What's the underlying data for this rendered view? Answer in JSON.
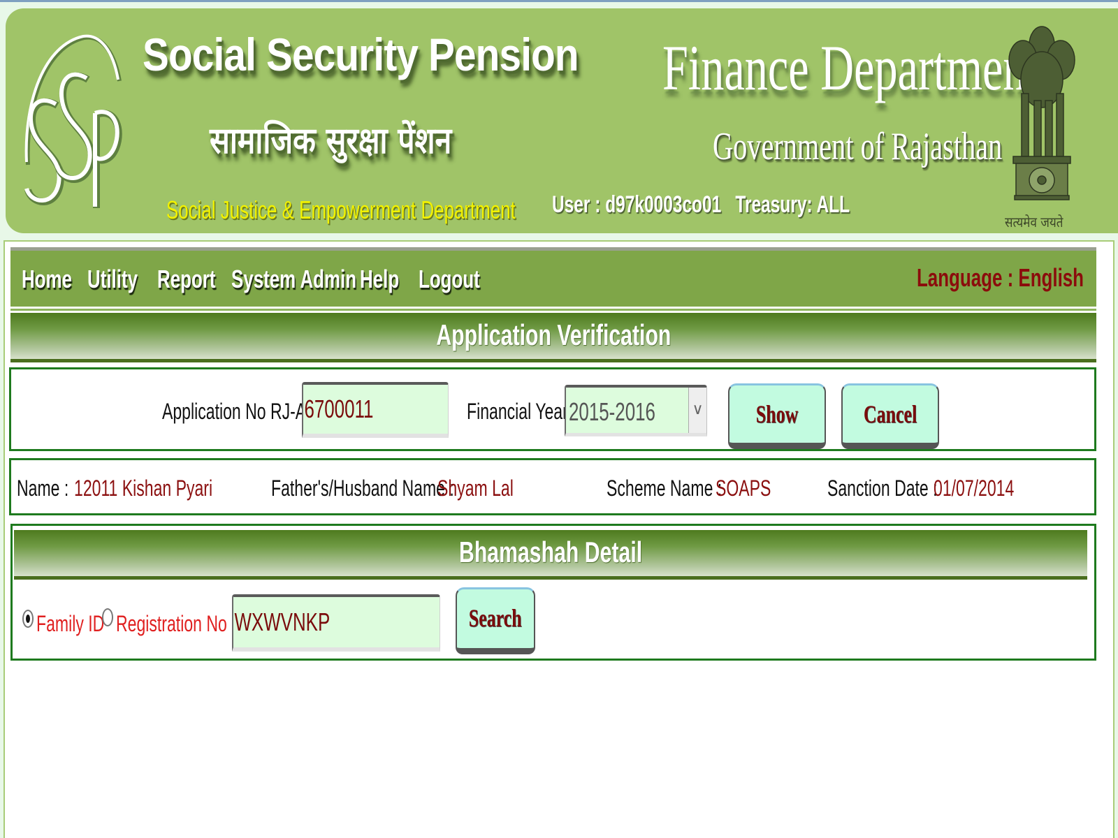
{
  "banner": {
    "logo_text": "SSP",
    "title_en": "Social Security Pension",
    "title_hi": "सामाजिक सुरक्षा पेंशन",
    "department": "Social Justice & Empowerment Department",
    "finance_dept": "Finance Department",
    "government": "Government of Rajasthan",
    "user_label": "User : d97k0003co01",
    "treasury_label": "Treasury: ALL",
    "emblem_motto": "सत्यमेव जयते"
  },
  "nav": {
    "items": [
      {
        "label": "Home"
      },
      {
        "label": "Utility"
      },
      {
        "label": "Report"
      },
      {
        "label": "System Admin"
      },
      {
        "label": "Help"
      },
      {
        "label": "Logout"
      }
    ],
    "language": "Language : English"
  },
  "verification": {
    "title": "Application Verification",
    "app_no_label": "Application No RJ-A-",
    "app_no_value": "6700011",
    "fy_label": "Financial Year",
    "fy_value": "2015-2016",
    "show_button": "Show",
    "cancel_button": "Cancel"
  },
  "applicant": {
    "name_label": "Name :",
    "name_value": "12011 Kishan Pyari",
    "father_label": "Father's/Husband Name :",
    "father_value": "Shyam Lal",
    "scheme_label": "Scheme Name :",
    "scheme_value": "SOAPS",
    "sanction_label": "Sanction Date :",
    "sanction_value": "01/07/2014"
  },
  "bhamashah": {
    "title": "Bhamashah Detail",
    "radio_family": "Family ID",
    "radio_registration": "Registration No",
    "selected": "Family ID",
    "search_value": "WXWVNKP",
    "search_button": "Search"
  },
  "colors": {
    "banner_green": "#a0c468",
    "nav_green": "#7fa648",
    "value_red": "#8b1010",
    "panel_border": "#1e7a1e",
    "button_fill": "#c2fbe0"
  }
}
